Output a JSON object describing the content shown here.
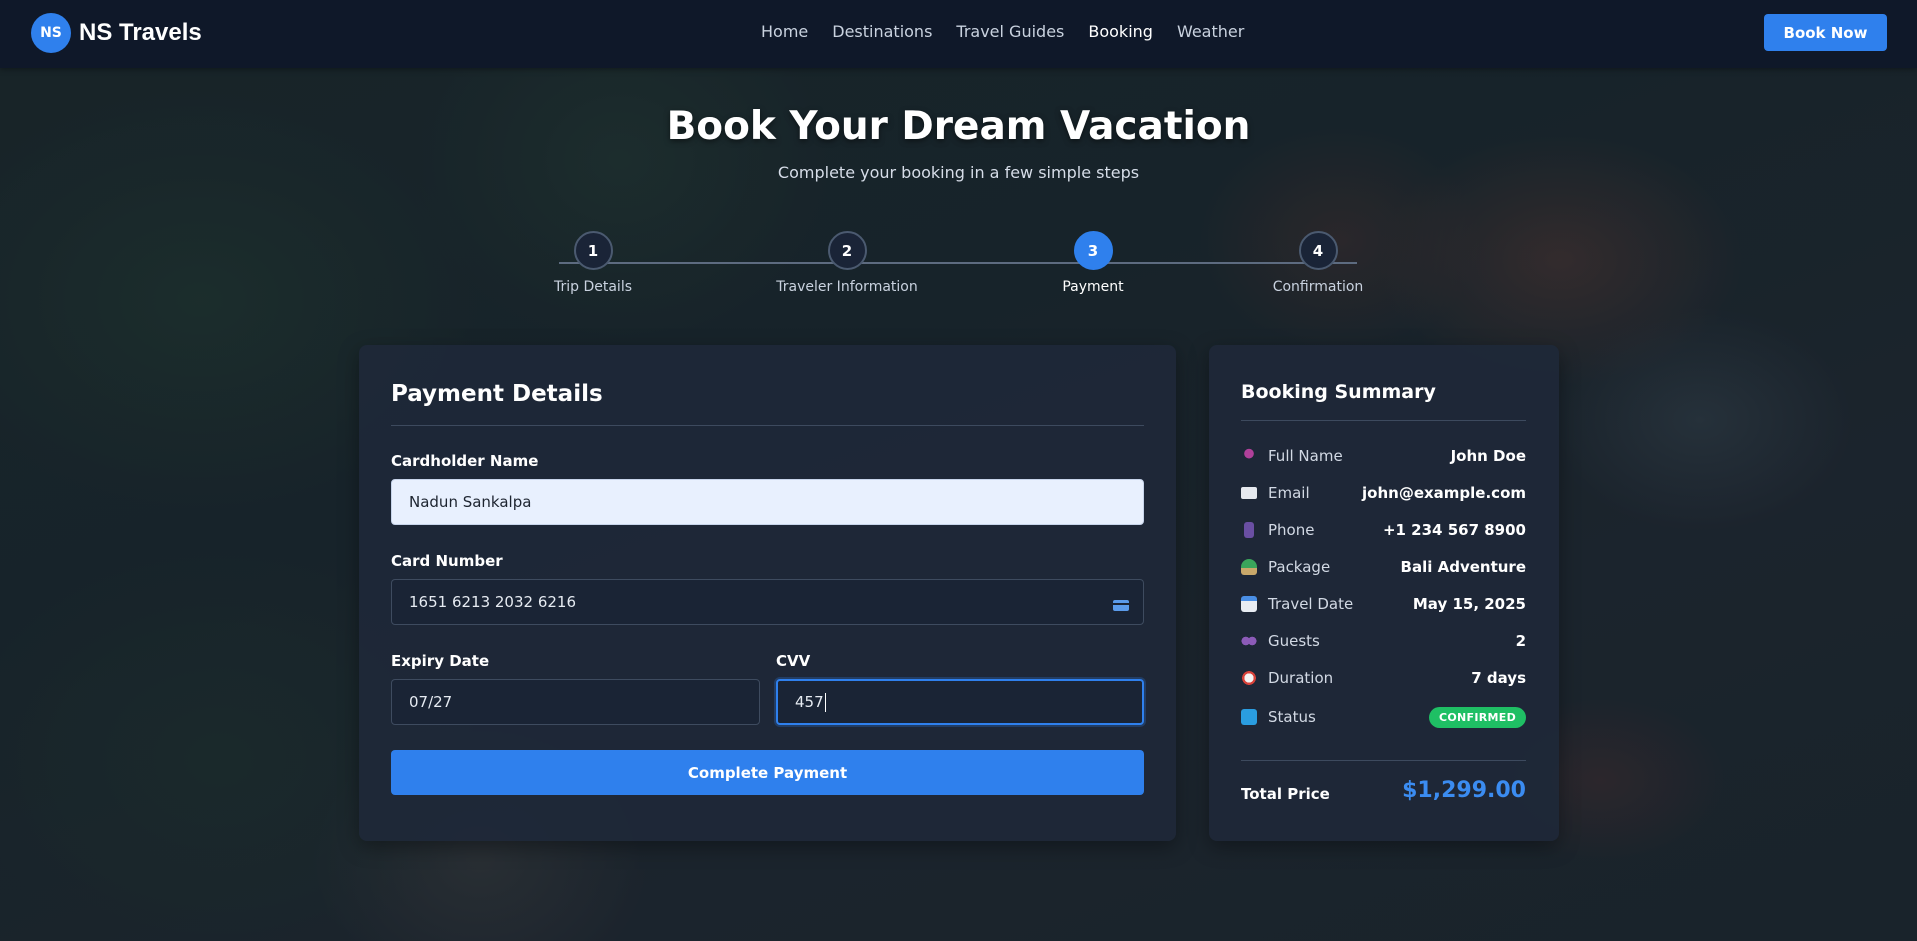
{
  "navbar": {
    "logo_text": "NS",
    "brand": "NS Travels",
    "links": [
      "Home",
      "Destinations",
      "Travel Guides",
      "Booking",
      "Weather"
    ],
    "active_link": "Booking",
    "cta_label": "Book Now"
  },
  "hero": {
    "title": "Book Your Dream Vacation",
    "subtitle": "Complete your booking in a few simple steps"
  },
  "stepper": {
    "steps": [
      {
        "number": "1",
        "label": "Trip Details"
      },
      {
        "number": "2",
        "label": "Traveler Information"
      },
      {
        "number": "3",
        "label": "Payment"
      },
      {
        "number": "4",
        "label": "Confirmation"
      }
    ],
    "active_step": "3"
  },
  "payment": {
    "title": "Payment Details",
    "cardholder_label": "Cardholder Name",
    "cardholder_value": "Nadun Sankalpa",
    "card_number_label": "Card Number",
    "card_number_value": "1651 6213 2032 6216",
    "expiry_label": "Expiry Date",
    "expiry_value": "07/27",
    "cvv_label": "CVV",
    "cvv_value": "457",
    "submit_label": "Complete Payment"
  },
  "summary": {
    "title": "Booking Summary",
    "rows": [
      {
        "icon": "person-icon",
        "label": "Full Name",
        "value": "John Doe"
      },
      {
        "icon": "envelope-icon",
        "label": "Email",
        "value": "john@example.com"
      },
      {
        "icon": "phone-icon",
        "label": "Phone",
        "value": "+1 234 567 8900"
      },
      {
        "icon": "island-icon",
        "label": "Package",
        "value": "Bali Adventure"
      },
      {
        "icon": "calendar-icon",
        "label": "Travel Date",
        "value": "May 15, 2025"
      },
      {
        "icon": "people-icon",
        "label": "Guests",
        "value": "2"
      },
      {
        "icon": "alarm-clock-icon",
        "label": "Duration",
        "value": "7 days"
      },
      {
        "icon": "refresh-icon",
        "label": "Status",
        "value": "CONFIRMED"
      }
    ],
    "total_label": "Total Price",
    "total_value": "$1,299.00"
  },
  "colors": {
    "accent": "#2f80ed",
    "navbar_bg": "#0f1829",
    "card_bg": "#1e2838",
    "status_green": "#1fbf64"
  }
}
